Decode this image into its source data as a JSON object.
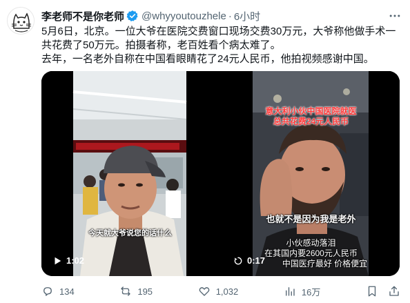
{
  "post": {
    "display_name": "李老师不是你老师",
    "handle": "@whyyoutouzhele",
    "separator": "·",
    "time": "6小时",
    "text_line1": "5月6日，北京。一位大爷在医院交费窗口现场交费30万元，大爷称他做手术一共花费了50万元。拍摄者称，老百姓看个病太难了。",
    "text_line2": "去年，一名老外自称在中国看眼睛花了24元人民币，他拍视频感谢中国。"
  },
  "media": {
    "left_video": {
      "duration": "1:02",
      "subtitle": "今天就大爷说您的话什么"
    },
    "right_video": {
      "duration": "0:17",
      "title_line1": "意大利小伙中国医院就医",
      "title_line2": "总共花费24元人民币",
      "subtitle": "也就不是因为我是老外",
      "caption_line1": "小伙感动落泪",
      "caption_line2": "在其国内要2600元人民币",
      "caption_line3": "中国医疗最好    价格便宜"
    }
  },
  "actions": {
    "replies": "134",
    "reposts": "195",
    "likes": "1,032",
    "views": "16万"
  },
  "icons": [
    "avatar-cat-sketch",
    "verified-badge-icon",
    "more-icon",
    "play-icon",
    "replay-icon",
    "reply-icon",
    "repost-icon",
    "like-icon",
    "views-icon",
    "bookmark-icon",
    "share-icon"
  ],
  "colors": {
    "verified": "#1d9bf0",
    "text": "#0f1419",
    "secondary": "#536471",
    "overlay_red": "#ff3a3a"
  }
}
